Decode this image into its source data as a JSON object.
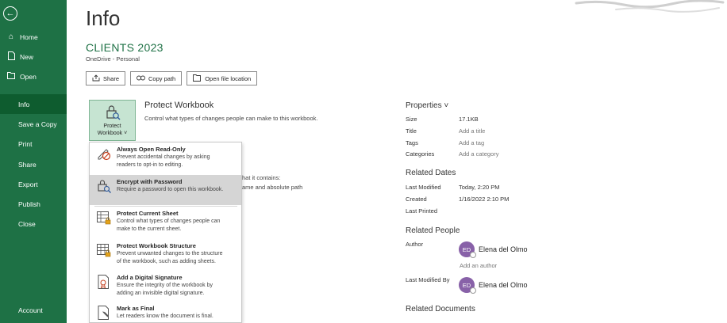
{
  "sidebar": {
    "items": [
      {
        "label": "Home",
        "icon": "home-icon"
      },
      {
        "label": "New",
        "icon": "new-document-icon"
      },
      {
        "label": "Open",
        "icon": "folder-open-icon"
      },
      {
        "label": "Info",
        "active": true
      },
      {
        "label": "Save a Copy"
      },
      {
        "label": "Print"
      },
      {
        "label": "Share"
      },
      {
        "label": "Export"
      },
      {
        "label": "Publish"
      },
      {
        "label": "Close"
      }
    ],
    "account": "Account",
    "background_color": "#1e7145"
  },
  "main": {
    "title": "Info",
    "doc_title": "CLIENTS 2023",
    "doc_location": "OneDrive - Personal",
    "buttons": {
      "share": "Share",
      "copy_path": "Copy path",
      "open_location": "Open file location"
    },
    "protect": {
      "button_line1": "Protect",
      "button_line2": "Workbook",
      "heading": "Protect Workbook",
      "description": "Control what types of changes people can make to this workbook."
    },
    "behind_text": {
      "line1": "hat it contains:",
      "line2": "ame and absolute path"
    }
  },
  "menu": {
    "items": [
      {
        "title": "Always Open Read-Only",
        "desc1": "Prevent accidental changes by asking",
        "desc2": "readers to opt-in to editing."
      },
      {
        "title": "Encrypt with Password",
        "desc1": "Require a password to open this workbook.",
        "desc2": ""
      },
      {
        "title": "Protect Current Sheet",
        "desc1": "Control what types of changes people can",
        "desc2": "make to the current sheet."
      },
      {
        "title": "Protect Workbook Structure",
        "desc1": "Prevent unwanted changes to the structure",
        "desc2": "of the workbook, such as adding sheets."
      },
      {
        "title": "Add a Digital Signature",
        "desc1": "Ensure the integrity of the workbook by",
        "desc2": "adding an invisible digital signature."
      },
      {
        "title": "Mark as Final",
        "desc1": "Let readers know the document is final.",
        "desc2": ""
      }
    ]
  },
  "properties": {
    "heading": "Properties ˅",
    "size_label": "Size",
    "size_value": "17.1KB",
    "title_label": "Title",
    "title_value": "Add a title",
    "tags_label": "Tags",
    "tags_value": "Add a tag",
    "categories_label": "Categories",
    "categories_value": "Add a category"
  },
  "related_dates": {
    "heading": "Related Dates",
    "last_modified_label": "Last Modified",
    "last_modified_value": "Today, 2:20 PM",
    "created_label": "Created",
    "created_value": "1/16/2022 2:10 PM",
    "last_printed_label": "Last Printed"
  },
  "related_people": {
    "heading": "Related People",
    "author_label": "Author",
    "author_initials": "ED",
    "author_name": "Elena del Olmo",
    "add_author": "Add an author",
    "last_modified_by_label": "Last Modified By",
    "modifier_initials": "ED",
    "modifier_name": "Elena del Olmo"
  },
  "related_documents": {
    "heading": "Related Documents"
  }
}
